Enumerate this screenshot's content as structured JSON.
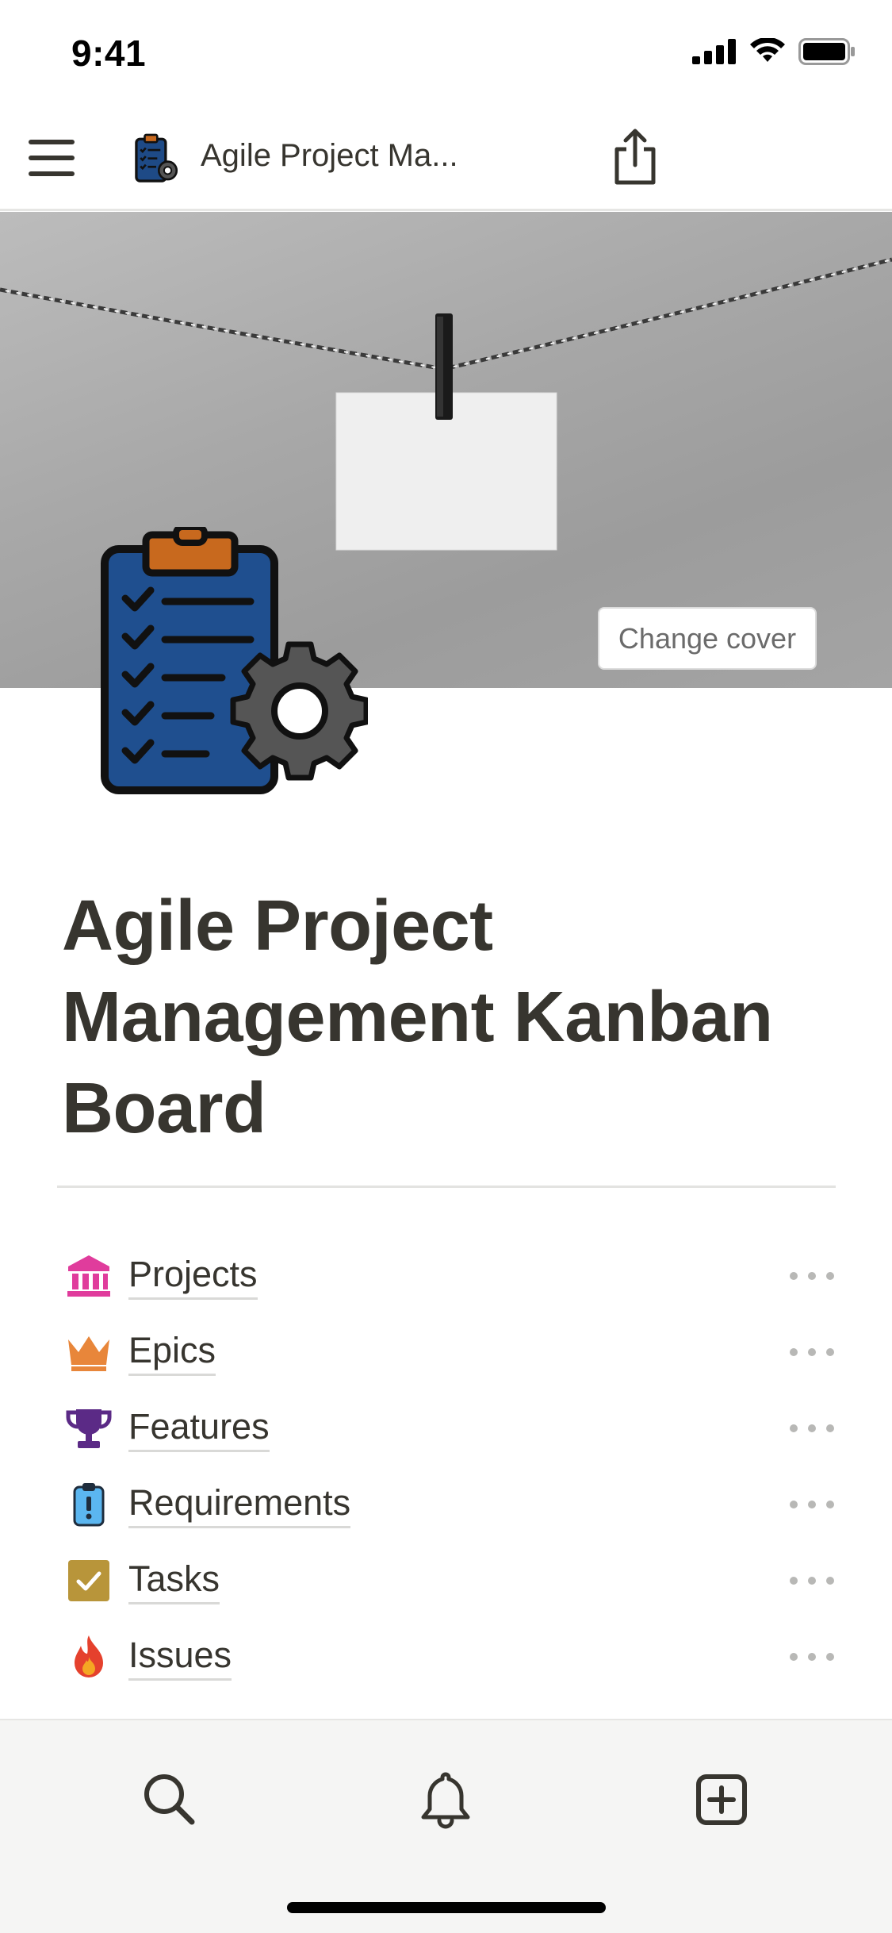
{
  "status_bar": {
    "time": "9:41"
  },
  "nav": {
    "title": "Agile Project Ma...",
    "icons": [
      "menu-icon",
      "clipboard-gear-icon",
      "share-icon"
    ]
  },
  "cover": {
    "change_cover_label": "Change cover"
  },
  "page": {
    "title": "Agile Project Management Kanban Board"
  },
  "list": {
    "items": [
      {
        "label": "Projects",
        "icon": "bank-icon",
        "color": "#e03c9c"
      },
      {
        "label": "Epics",
        "icon": "crown-icon",
        "color": "#e8863a"
      },
      {
        "label": "Features",
        "icon": "trophy-icon",
        "color": "#5b2a86"
      },
      {
        "label": "Requirements",
        "icon": "clipboard-alert-icon",
        "color": "#2f8fd8"
      },
      {
        "label": "Tasks",
        "icon": "checkbox-icon",
        "color": "#b8953a"
      },
      {
        "label": "Issues",
        "icon": "fire-icon",
        "color": "#e5412d"
      }
    ]
  },
  "bottom_bar": {
    "tabs": [
      "search-icon",
      "bell-icon",
      "new-page-icon"
    ]
  }
}
